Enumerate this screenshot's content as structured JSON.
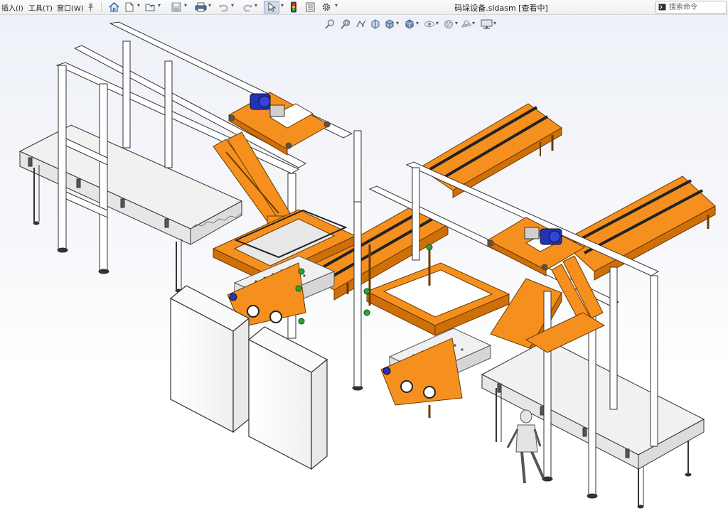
{
  "menu": {
    "insert": "插入(I)",
    "tools": "工具(T)",
    "window": "窗口(W)"
  },
  "toolbar": {
    "icons": [
      "pin-icon",
      "home-icon",
      "new-document-icon",
      "open-file-icon",
      "save-icon",
      "print-icon",
      "undo-icon",
      "redo-icon",
      "select-arrow-icon",
      "rebuild-icon",
      "file-properties-icon",
      "options-gear-icon"
    ]
  },
  "document": {
    "title": "码垛设备.sldasm [查看中]"
  },
  "search": {
    "placeholder": "搜索命令"
  },
  "heads_up_toolbar": {
    "icons": [
      "zoom-to-fit-icon",
      "zoom-to-area-icon",
      "previous-view-icon",
      "section-view-icon",
      "view-orientation-icon",
      "display-style-icon",
      "hide-show-items-icon",
      "edit-appearance-icon",
      "apply-scene-icon",
      "view-settings-icon"
    ]
  },
  "colors": {
    "frame_orange": "#f5901e",
    "frame_edge": "#7a4200",
    "steel_white": "#ffffff",
    "motor_blue": "#2233bb",
    "belt_dark": "#333333",
    "highlight_green": "#22aa33"
  }
}
